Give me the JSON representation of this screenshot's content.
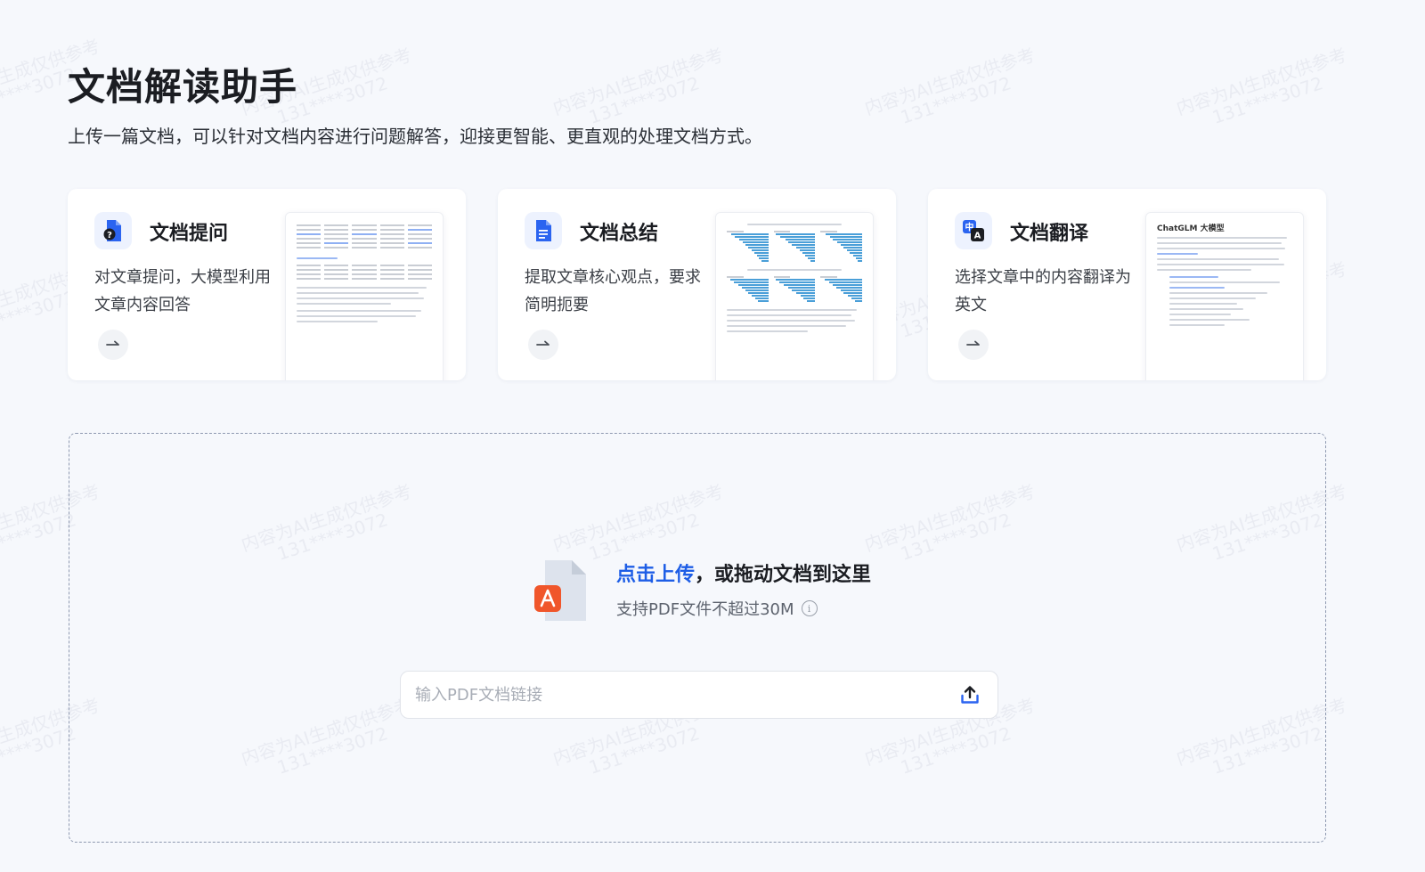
{
  "header": {
    "title": "文档解读助手",
    "subtitle": "上传一篇文档，可以针对文档内容进行问题解答，迎接更智能、更直观的处理文档方式。"
  },
  "cards": [
    {
      "title": "文档提问",
      "desc": "对文章提问，大模型利用文章内容回答",
      "icon": "doc-question-icon",
      "preview_title": ""
    },
    {
      "title": "文档总结",
      "desc": "提取文章核心观点，要求简明扼要",
      "icon": "doc-summary-icon",
      "preview_title": ""
    },
    {
      "title": "文档翻译",
      "desc": "选择文章中的内容翻译为英文",
      "icon": "doc-translate-icon",
      "preview_title": "ChatGLM 大模型"
    }
  ],
  "upload": {
    "link_text": "点击上传",
    "title_rest": "，或拖动文档到这里",
    "hint": "支持PDF文件不超过30M",
    "url_placeholder": "输入PDF文档链接"
  },
  "watermark": {
    "line1": "内容为AI生成仅供参考",
    "line2": "131****3072"
  },
  "colors": {
    "accent": "#1e5ee6",
    "icon_blue": "#2b64f0",
    "pdf_red": "#f0562b",
    "background": "#f6f8fc"
  }
}
